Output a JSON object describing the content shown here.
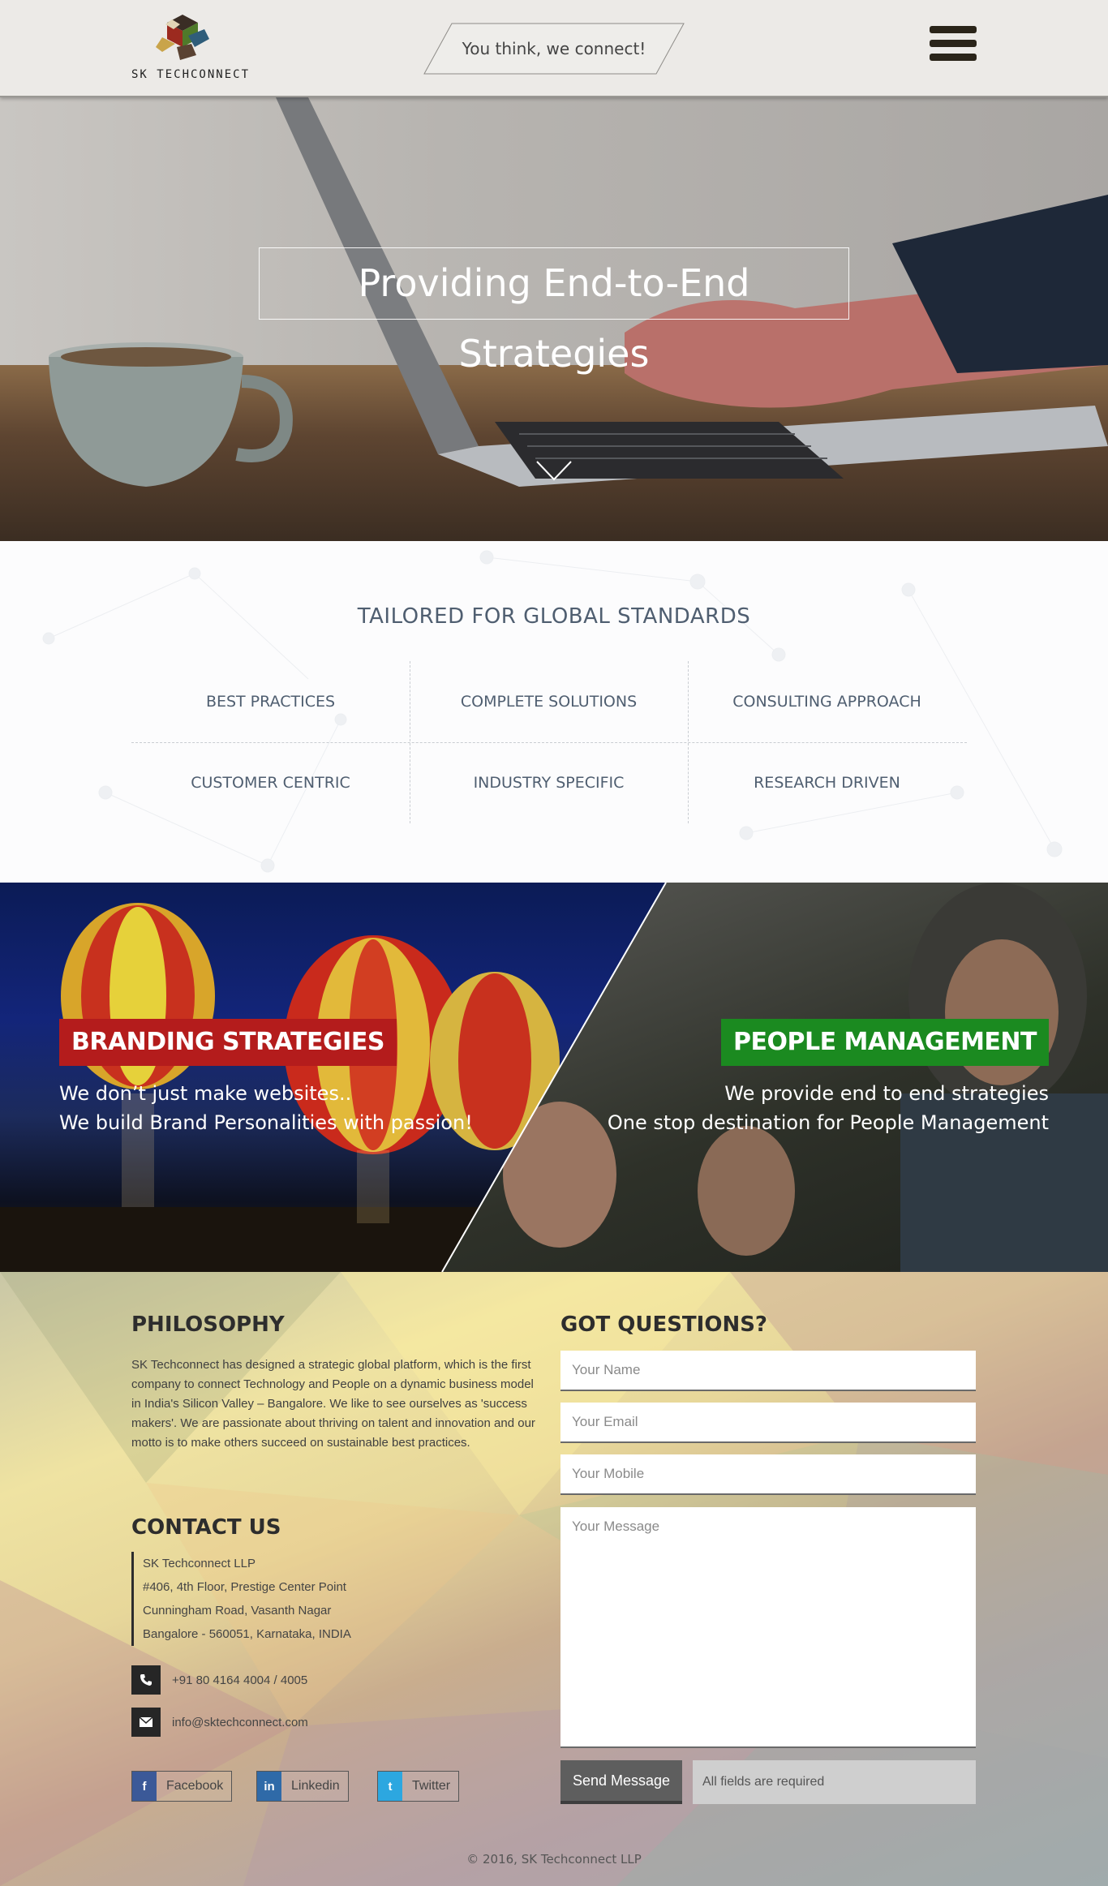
{
  "header": {
    "logo_text": "SK TECHCONNECT",
    "tagline": "You think, we connect!",
    "menu_icon": "hamburger-menu-icon"
  },
  "hero": {
    "title": "Providing End-to-End Strategies",
    "scroll_icon": "chevron-down-icon"
  },
  "standards": {
    "title": "TAILORED FOR GLOBAL STANDARDS",
    "items": [
      "BEST PRACTICES",
      "COMPLETE SOLUTIONS",
      "CONSULTING APPROACH",
      "CUSTOMER CENTRIC",
      "INDUSTRY SPECIFIC",
      "RESEARCH DRIVEN"
    ]
  },
  "split": {
    "left": {
      "badge": "BRANDING STRATEGIES",
      "badge_color": "#b41c1c",
      "line1": "We don’t just make websites..",
      "line2": "We build Brand Personalities with passion!"
    },
    "right": {
      "badge": "PEOPLE MANAGEMENT",
      "badge_color": "#1b8a20",
      "line1": "We provide end to end strategies",
      "line2": "One stop destination for People Management"
    }
  },
  "philosophy": {
    "title": "PHILOSOPHY",
    "text": "SK Techconnect has designed a strategic global platform, which is the first company to connect Technology and People on a dynamic business model in India's Silicon Valley – Bangalore. We like to see ourselves as 'success makers'. We are passionate about thriving on talent and innovation and our motto is to make others succeed on sustainable best practices."
  },
  "contact": {
    "title": "CONTACT US",
    "address": [
      "SK Techconnect LLP",
      "#406, 4th Floor, Prestige Center Point",
      "Cunningham Road, Vasanth Nagar",
      "Bangalore - 560051, Karnataka, INDIA"
    ],
    "phone": "+91 80 4164 4004 / 4005",
    "email": "info@sktechconnect.com"
  },
  "social": [
    {
      "label": "Facebook",
      "icon": "facebook-icon",
      "glyph": "f",
      "color": "#3b5998"
    },
    {
      "label": "Linkedin",
      "icon": "linkedin-icon",
      "glyph": "in",
      "color": "#2f6aa8"
    },
    {
      "label": "Twitter",
      "icon": "twitter-icon",
      "glyph": "t",
      "color": "#2ca7e0"
    }
  ],
  "form": {
    "title": "GOT QUESTIONS?",
    "name_placeholder": "Your Name",
    "email_placeholder": "Your Email",
    "mobile_placeholder": "Your Mobile",
    "message_placeholder": "Your Message",
    "send_label": "Send Message",
    "required_note": "All fields are required"
  },
  "footer": {
    "copyright": "© 2016, SK Techconnect LLP"
  }
}
